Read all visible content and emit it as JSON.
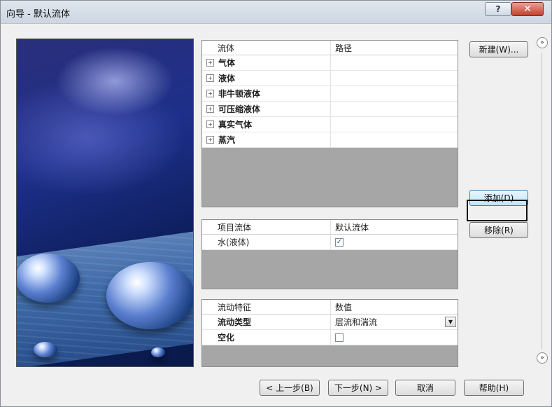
{
  "window": {
    "title": "向导 - 默认流体",
    "help_symbol": "?",
    "close_symbol": "✕"
  },
  "fluids_table": {
    "headers": [
      "流体",
      "路径"
    ],
    "rows": [
      {
        "label": "气体",
        "expand": "+"
      },
      {
        "label": "液体",
        "expand": "+"
      },
      {
        "label": "非牛顿液体",
        "expand": "+"
      },
      {
        "label": "可压缩液体",
        "expand": "+"
      },
      {
        "label": "真实气体",
        "expand": "+"
      },
      {
        "label": "蒸汽",
        "expand": "+"
      }
    ]
  },
  "project_table": {
    "headers": [
      "项目流体",
      "默认流体"
    ],
    "rows": [
      {
        "label": "水(液体)",
        "default_checked": true
      }
    ]
  },
  "flow_table": {
    "headers": [
      "流动特征",
      "数值"
    ],
    "rows": [
      {
        "label": "流动类型",
        "value": "层流和湍流",
        "kind": "select"
      },
      {
        "label": "空化",
        "value": "",
        "kind": "checkbox",
        "checked": false
      }
    ]
  },
  "buttons": {
    "new": "新建(W)...",
    "add": "添加(D)",
    "remove": "移除(R)",
    "back": "< 上一步(B)",
    "next": "下一步(N) >",
    "cancel": "取消",
    "help": "帮助(H)"
  },
  "expand_symbol": "»",
  "dropdown_symbol": "▼",
  "check_symbol": "✓"
}
